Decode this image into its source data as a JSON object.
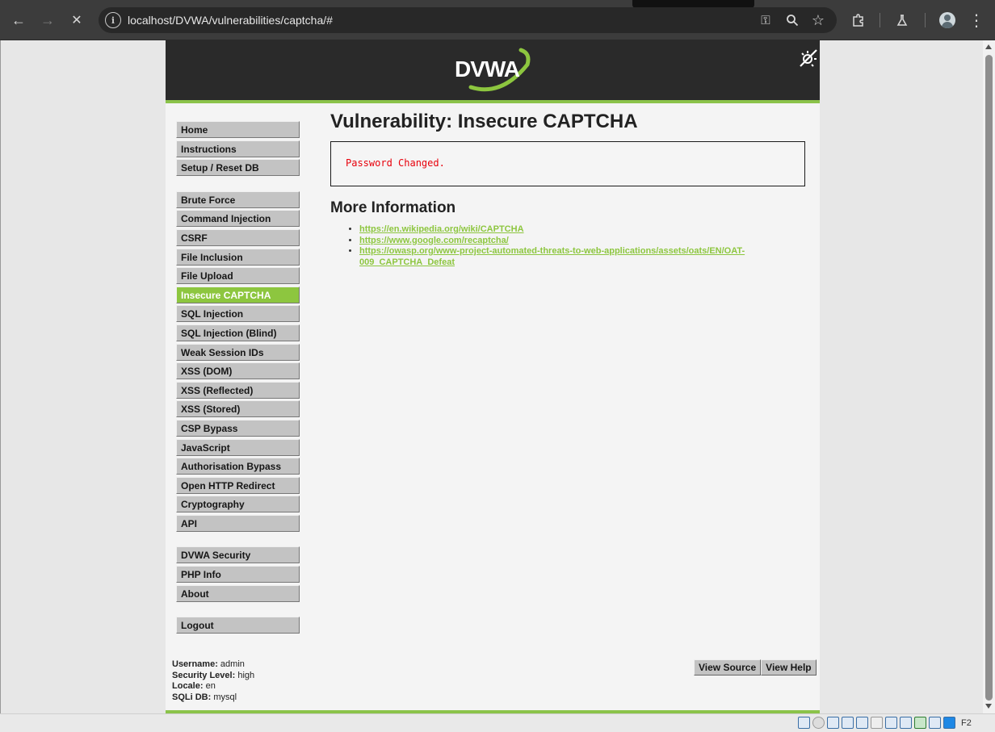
{
  "browser": {
    "url": "localhost/DVWA/vulnerabilities/captcha/#",
    "back_icon": "←",
    "forward_icon": "→",
    "stop_icon": "✕",
    "site_info_icon": "i",
    "key_icon": "⚿",
    "zoom_icon": "⚲",
    "bookmark_icon": "☆",
    "extensions_icon": "⧉",
    "labs_icon": "⚗",
    "menu_icon": "⋮"
  },
  "header": {
    "logo_text": "DVWA"
  },
  "menu": {
    "group1": [
      "Home",
      "Instructions",
      "Setup / Reset DB"
    ],
    "group2": [
      "Brute Force",
      "Command Injection",
      "CSRF",
      "File Inclusion",
      "File Upload",
      "Insecure CAPTCHA",
      "SQL Injection",
      "SQL Injection (Blind)",
      "Weak Session IDs",
      "XSS (DOM)",
      "XSS (Reflected)",
      "XSS (Stored)",
      "CSP Bypass",
      "JavaScript",
      "Authorisation Bypass",
      "Open HTTP Redirect",
      "Cryptography",
      "API"
    ],
    "group3": [
      "DVWA Security",
      "PHP Info",
      "About"
    ],
    "group4": [
      "Logout"
    ],
    "selected": "Insecure CAPTCHA"
  },
  "main": {
    "title": "Vulnerability: Insecure CAPTCHA",
    "message": "Password Changed.",
    "more_info_heading": "More Information",
    "links": [
      "https://en.wikipedia.org/wiki/CAPTCHA",
      "https://www.google.com/recaptcha/",
      "https://owasp.org/www-project-automated-threats-to-web-applications/assets/oats/EN/OAT-009_CAPTCHA_Defeat"
    ]
  },
  "footer": {
    "username_label": "Username:",
    "username": "admin",
    "security_label": "Security Level:",
    "security": "high",
    "locale_label": "Locale:",
    "locale": "en",
    "sqli_label": "SQLi DB:",
    "sqli": "mysql",
    "view_source": "View Source",
    "view_help": "View Help"
  },
  "statusbar": {
    "host_key": "F2"
  },
  "colors": {
    "accent_green": "#8dc63f",
    "header_dark": "#2a2a2a",
    "error_red": "#e8000b"
  }
}
